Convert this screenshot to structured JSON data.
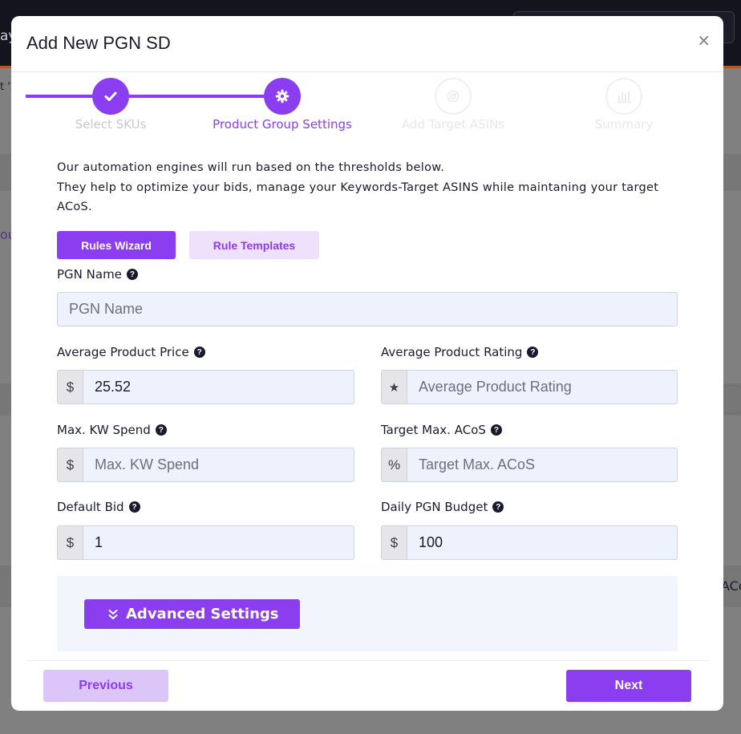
{
  "backdrop": {
    "fragments": [
      "ay",
      "t '2",
      "ou",
      "ACo"
    ]
  },
  "modal": {
    "title": "Add New PGN SD",
    "close_icon": "×"
  },
  "stepper": {
    "steps": [
      {
        "label": "Select SKUs",
        "state": "done",
        "icon": "check-icon"
      },
      {
        "label": "Product Group Settings",
        "state": "active",
        "icon": "gear-icon"
      },
      {
        "label": "Add Target ASINs",
        "state": "pending",
        "icon": "target-icon"
      },
      {
        "label": "Summary",
        "state": "pending",
        "icon": "bar-chart-icon"
      }
    ]
  },
  "intro": {
    "line1": "Our automation engines will run based on the thresholds below.",
    "line2": "They help to optimize your bids, manage your Keywords-Target ASINS while maintaning your target ACoS."
  },
  "tabs": {
    "rules_wizard": "Rules Wizard",
    "rule_templates": "Rule Templates"
  },
  "form": {
    "pgn_name": {
      "label": "PGN Name",
      "value": "",
      "placeholder": "PGN Name"
    },
    "avg_price": {
      "label": "Average Product Price",
      "addon": "$",
      "value": "25.52",
      "placeholder": ""
    },
    "avg_rating": {
      "label": "Average Product Rating",
      "addon": "★",
      "value": "",
      "placeholder": "Average Product Rating"
    },
    "max_kw_spend": {
      "label": "Max. KW Spend",
      "addon": "$",
      "value": "",
      "placeholder": "Max. KW Spend"
    },
    "target_max_acos": {
      "label": "Target Max. ACoS",
      "addon": "%",
      "value": "",
      "placeholder": "Target Max. ACoS"
    },
    "default_bid": {
      "label": "Default Bid",
      "addon": "$",
      "value": "1",
      "placeholder": ""
    },
    "daily_budget": {
      "label": "Daily PGN Budget",
      "addon": "$",
      "value": "100",
      "placeholder": ""
    },
    "help_icon": "?"
  },
  "advanced": {
    "label": "Advanced Settings",
    "icon": "double-chevron-down-icon",
    "chevron": "⌄"
  },
  "footer": {
    "previous": "Previous",
    "next": "Next"
  },
  "colors": {
    "accent": "#8b3df0",
    "accent_light": "#efe0fb",
    "input_bg": "#eef2fd"
  }
}
